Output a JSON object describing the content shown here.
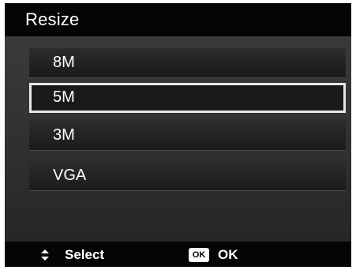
{
  "header": {
    "title": "Resize"
  },
  "menu": {
    "items": [
      {
        "label": "8M",
        "selected": false
      },
      {
        "label": "5M",
        "selected": true
      },
      {
        "label": "3M",
        "selected": false
      },
      {
        "label": "VGA",
        "selected": false
      }
    ]
  },
  "footer": {
    "nav_icon": "up-down-arrows-icon",
    "nav_label": "Select",
    "ok_icon_text": "OK",
    "ok_label": "OK"
  },
  "colors": {
    "background": "#2a2a2a",
    "title_bar": "#050505",
    "selection_border": "#e8e8e8",
    "text": "#ffffff"
  }
}
